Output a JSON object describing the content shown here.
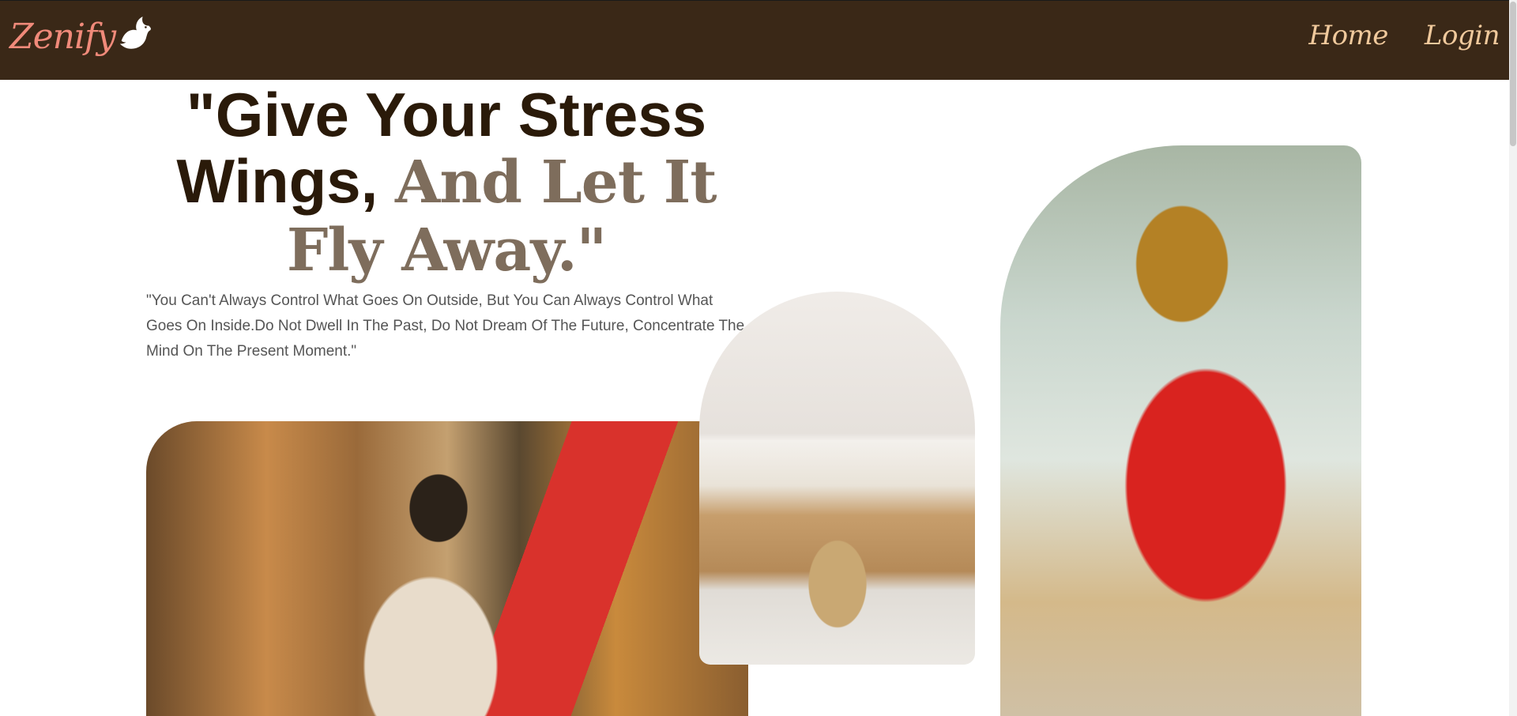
{
  "navbar": {
    "brand": "Zenify",
    "brand_icon": "dove-icon",
    "links": [
      {
        "label": "Home"
      },
      {
        "label": "Login"
      }
    ],
    "colors": {
      "background": "#3a2817",
      "brand": "#f08a7a",
      "link": "#f0c99c"
    }
  },
  "hero": {
    "headline_main": "\"Give Your Stress Wings,",
    "headline_accent": "And Let It Fly Away.\"",
    "quote": "\"You Can't Always Control What Goes On Outside, But You Can Always Control What Goes On Inside.Do Not Dwell In The Past, Do Not Dream Of The Future, Concentrate The Mind On The Present Moment.\"",
    "colors": {
      "headline": "#2a1a09",
      "accent": "#7e6d5c",
      "quote": "#555555"
    }
  }
}
